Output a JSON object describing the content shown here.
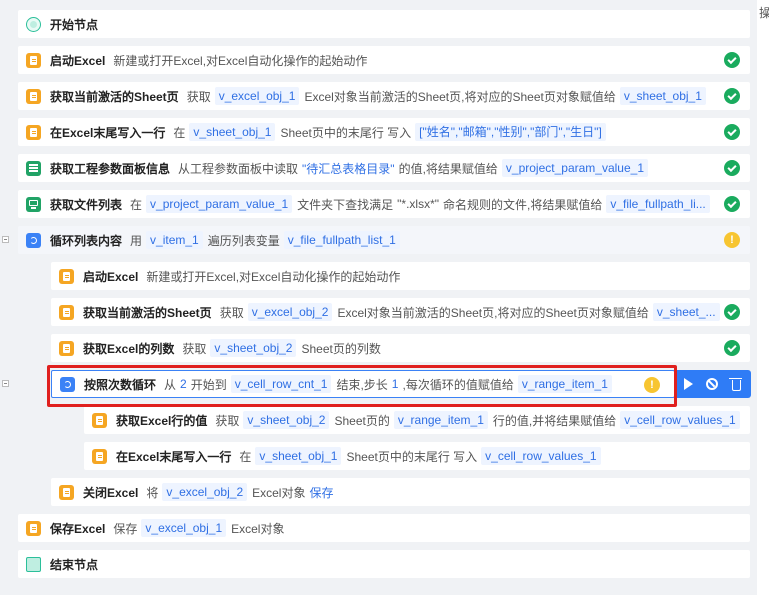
{
  "right_panel_tab_char": "操",
  "flow": [
    {
      "id": "start",
      "icon": "start-node-icon",
      "title": "开始节点",
      "parts": [],
      "status": ""
    },
    {
      "id": "launch-excel-1",
      "icon": "excel-icon",
      "title": "启动Excel",
      "parts": [
        {
          "t": "txt",
          "v": "新建或打开Excel,对Excel自动化操作的起始动作"
        }
      ],
      "status": "ok"
    },
    {
      "id": "get-active-sheet-1",
      "icon": "excel-icon",
      "title": "获取当前激活的Sheet页",
      "parts": [
        {
          "t": "txt",
          "v": "获取"
        },
        {
          "t": "var",
          "v": "v_excel_obj_1"
        },
        {
          "t": "txt",
          "v": "Excel对象当前激活的Sheet页,将对应的Sheet页对象赋值给"
        },
        {
          "t": "var",
          "v": "v_sheet_obj_1"
        }
      ],
      "status": "ok"
    },
    {
      "id": "append-row-1",
      "icon": "excel-icon",
      "title": "在Excel末尾写入一行",
      "parts": [
        {
          "t": "txt",
          "v": "在"
        },
        {
          "t": "var",
          "v": "v_sheet_obj_1"
        },
        {
          "t": "txt",
          "v": "Sheet页中的末尾行 写入"
        },
        {
          "t": "var",
          "v": "[\"姓名\",\"邮箱\",\"性别\",\"部门\",\"生日\"]"
        }
      ],
      "status": "ok"
    },
    {
      "id": "get-project-param",
      "icon": "param-icon",
      "title": "获取工程参数面板信息",
      "parts": [
        {
          "t": "txt",
          "v": "从工程参数面板中读取"
        },
        {
          "t": "blue",
          "v": "\"待汇总表格目录\""
        },
        {
          "t": "txt",
          "v": "的值,将结果赋值给"
        },
        {
          "t": "var",
          "v": "v_project_param_value_1"
        }
      ],
      "status": "ok"
    },
    {
      "id": "get-file-list",
      "icon": "file-list-icon",
      "title": "获取文件列表",
      "parts": [
        {
          "t": "txt",
          "v": "在"
        },
        {
          "t": "var",
          "v": "v_project_param_value_1"
        },
        {
          "t": "txt",
          "v": "文件夹下查找满足"
        },
        {
          "t": "txt",
          "v": "\"*.xlsx*\""
        },
        {
          "t": "txt",
          "v": "命名规则的文件,将结果赋值给"
        },
        {
          "t": "var",
          "v": "v_file_fullpath_li..."
        }
      ],
      "status": "ok"
    },
    {
      "id": "loop-list",
      "icon": "loop-icon",
      "title": "循环列表内容",
      "parts": [
        {
          "t": "txt",
          "v": "用"
        },
        {
          "t": "var",
          "v": "v_item_1"
        },
        {
          "t": "txt",
          "v": "遍历列表变量"
        },
        {
          "t": "var",
          "v": "v_file_fullpath_list_1"
        }
      ],
      "status": "warn"
    },
    {
      "id": "launch-excel-2",
      "icon": "excel-icon",
      "title": "启动Excel",
      "parts": [
        {
          "t": "txt",
          "v": "新建或打开Excel,对Excel自动化操作的起始动作"
        }
      ],
      "status": ""
    },
    {
      "id": "get-active-sheet-2",
      "icon": "excel-icon",
      "title": "获取当前激活的Sheet页",
      "parts": [
        {
          "t": "txt",
          "v": "获取"
        },
        {
          "t": "var",
          "v": "v_excel_obj_2"
        },
        {
          "t": "txt",
          "v": "Excel对象当前激活的Sheet页,将对应的Sheet页对象赋值给"
        },
        {
          "t": "var",
          "v": "v_sheet_..."
        }
      ],
      "status": "ok"
    },
    {
      "id": "get-column-count",
      "icon": "excel-icon",
      "title": "获取Excel的列数",
      "parts": [
        {
          "t": "txt",
          "v": "获取"
        },
        {
          "t": "var",
          "v": "v_sheet_obj_2"
        },
        {
          "t": "txt",
          "v": "Sheet页的列数"
        }
      ],
      "status": "ok"
    },
    {
      "id": "count-loop",
      "icon": "loop-icon",
      "title": "按照次数循环",
      "parts": [
        {
          "t": "txt",
          "v": "从"
        },
        {
          "t": "num",
          "v": "2"
        },
        {
          "t": "txt",
          "v": "开始到"
        },
        {
          "t": "var",
          "v": "v_cell_row_cnt_1"
        },
        {
          "t": "txt",
          "v": "结束,步长"
        },
        {
          "t": "num",
          "v": "1"
        },
        {
          "t": "txt",
          "v": ",每次循环的值赋值给"
        },
        {
          "t": "var",
          "v": "v_range_item_1"
        }
      ],
      "status": "warn"
    },
    {
      "id": "get-row-values",
      "icon": "excel-icon",
      "title": "获取Excel行的值",
      "parts": [
        {
          "t": "txt",
          "v": "获取"
        },
        {
          "t": "var",
          "v": "v_sheet_obj_2"
        },
        {
          "t": "txt",
          "v": "Sheet页的"
        },
        {
          "t": "var",
          "v": "v_range_item_1"
        },
        {
          "t": "txt",
          "v": "行的值,并将结果赋值给"
        },
        {
          "t": "var",
          "v": "v_cell_row_values_1"
        }
      ],
      "status": ""
    },
    {
      "id": "append-row-2",
      "icon": "excel-icon",
      "title": "在Excel末尾写入一行",
      "parts": [
        {
          "t": "txt",
          "v": "在"
        },
        {
          "t": "var",
          "v": "v_sheet_obj_1"
        },
        {
          "t": "txt",
          "v": "Sheet页中的末尾行 写入"
        },
        {
          "t": "var",
          "v": "v_cell_row_values_1"
        }
      ],
      "status": ""
    },
    {
      "id": "close-excel",
      "icon": "excel-icon",
      "title": "关闭Excel",
      "parts": [
        {
          "t": "txt",
          "v": "将"
        },
        {
          "t": "var",
          "v": "v_excel_obj_2"
        },
        {
          "t": "txt",
          "v": "Excel对象"
        },
        {
          "t": "blue",
          "v": "保存"
        }
      ],
      "status": ""
    },
    {
      "id": "save-excel",
      "icon": "excel-icon",
      "title": "保存Excel",
      "parts": [
        {
          "t": "txt",
          "v": "保存"
        },
        {
          "t": "var",
          "v": "v_excel_obj_1"
        },
        {
          "t": "txt",
          "v": "Excel对象"
        }
      ],
      "status": ""
    },
    {
      "id": "end",
      "icon": "end-node-icon",
      "title": "结束节点",
      "parts": [],
      "status": ""
    }
  ]
}
